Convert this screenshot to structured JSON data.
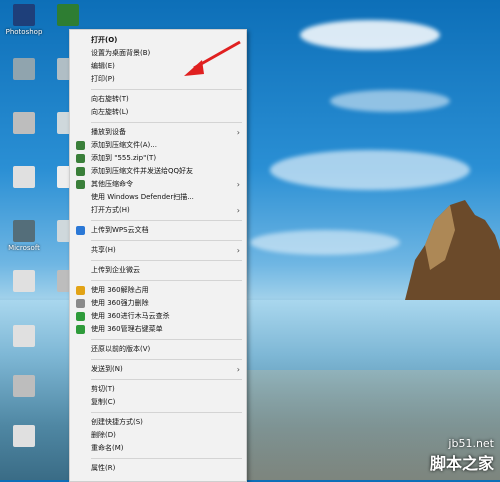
{
  "desktop": {
    "icons": [
      {
        "label": "Photoshop",
        "color": "#1e3f7a"
      },
      {
        "label": "",
        "color": "#2e7d32"
      },
      {
        "label": "",
        "color": "#90a4ae"
      },
      {
        "label": "",
        "color": "#b0bec5"
      },
      {
        "label": "",
        "color": "#bdbdbd"
      },
      {
        "label": "",
        "color": "#cfd8dc"
      },
      {
        "label": "",
        "color": "#e0e0e0"
      },
      {
        "label": "",
        "color": "#eeeeee"
      },
      {
        "label": "Microsoft",
        "color": "#546e7a"
      },
      {
        "label": "",
        "color": "#cfd8dc"
      },
      {
        "label": "",
        "color": "#e0e0e0"
      },
      {
        "label": "",
        "color": "#bdbdbd"
      },
      {
        "label": "",
        "color": "#e0e0e0"
      },
      {
        "label": "",
        "color": "#bdbdbd"
      },
      {
        "label": "",
        "color": "#e0e0e0"
      }
    ]
  },
  "menu": {
    "items": [
      {
        "label": "打开(O)",
        "bold": true
      },
      {
        "label": "设置为桌面背景(B)"
      },
      {
        "label": "编辑(E)"
      },
      {
        "label": "打印(P)"
      },
      {
        "sep": true
      },
      {
        "label": "向右旋转(T)"
      },
      {
        "label": "向左旋转(L)"
      },
      {
        "sep": true
      },
      {
        "label": "播放到设备",
        "sub": true
      },
      {
        "label": "添加到压缩文件(A)...",
        "icon": "archive-icon",
        "iconColor": "#3a7f3a"
      },
      {
        "label": "添加到 \"555.zip\"(T)",
        "icon": "archive-icon",
        "iconColor": "#3a7f3a"
      },
      {
        "label": "添加到压缩文件并发送给QQ好友",
        "icon": "archive-icon",
        "iconColor": "#3a7f3a"
      },
      {
        "label": "其他压缩命令",
        "icon": "archive-icon",
        "iconColor": "#3a7f3a",
        "sub": true
      },
      {
        "label": "使用 Windows Defender扫描..."
      },
      {
        "label": "打开方式(H)",
        "sub": true
      },
      {
        "sep": true
      },
      {
        "label": "上传到WPS云文档",
        "icon": "cloud-icon",
        "iconColor": "#2b78d6"
      },
      {
        "sep": true
      },
      {
        "label": "共享(H)",
        "sub": true
      },
      {
        "sep": true
      },
      {
        "label": "上传到企业微云"
      },
      {
        "sep": true
      },
      {
        "label": "使用 360解除占用",
        "icon": "unlock-icon",
        "iconColor": "#e2a316"
      },
      {
        "label": "使用 360强力删除",
        "icon": "delete-icon",
        "iconColor": "#8a8a8a"
      },
      {
        "label": "使用 360进行木马云查杀",
        "icon": "shield-icon",
        "iconColor": "#2e9b3a"
      },
      {
        "label": "使用 360管理右键菜单",
        "icon": "shield-icon",
        "iconColor": "#2e9b3a"
      },
      {
        "sep": true
      },
      {
        "label": "还原以前的版本(V)"
      },
      {
        "sep": true
      },
      {
        "label": "发送到(N)",
        "sub": true
      },
      {
        "sep": true
      },
      {
        "label": "剪切(T)"
      },
      {
        "label": "复制(C)"
      },
      {
        "sep": true
      },
      {
        "label": "创建快捷方式(S)"
      },
      {
        "label": "删除(D)"
      },
      {
        "label": "重命名(M)"
      },
      {
        "sep": true
      },
      {
        "label": "属性(R)"
      }
    ]
  },
  "watermark": {
    "url": "jb51.net",
    "brand": "脚本之家"
  }
}
